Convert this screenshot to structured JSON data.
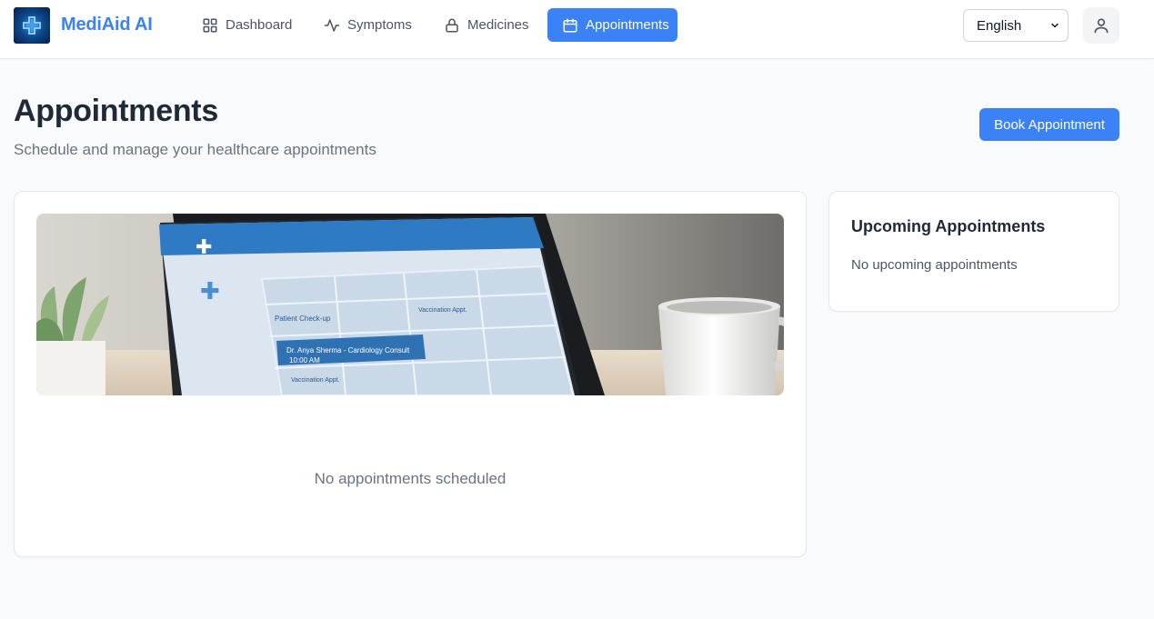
{
  "app": {
    "brand": "MediAid AI"
  },
  "nav": {
    "items": [
      {
        "label": "Dashboard",
        "icon": "grid-icon",
        "active": false
      },
      {
        "label": "Symptoms",
        "icon": "activity-icon",
        "active": false
      },
      {
        "label": "Medicines",
        "icon": "lock-icon",
        "active": false
      },
      {
        "label": "Appointments",
        "icon": "calendar-icon",
        "active": true
      }
    ]
  },
  "language": {
    "selected": "English"
  },
  "header": {
    "title": "Appointments",
    "subtitle": "Schedule and manage your healthcare appointments",
    "book_label": "Book Appointment"
  },
  "main": {
    "empty_text": "No appointments scheduled",
    "hero_calendar": {
      "event_1": "Patient Check-up",
      "event_2": "Vaccination Appt.",
      "event_3_line1": "Dr. Anya Sherma - Cardiology Consult",
      "event_3_line2": "10:00 AM",
      "event_4": "Vaccination Appt."
    }
  },
  "sidebar": {
    "title": "Upcoming Appointments",
    "empty_text": "No upcoming appointments"
  },
  "colors": {
    "accent": "#3b82f6",
    "text_dark": "#1f2937",
    "text_muted": "#6b7280"
  }
}
